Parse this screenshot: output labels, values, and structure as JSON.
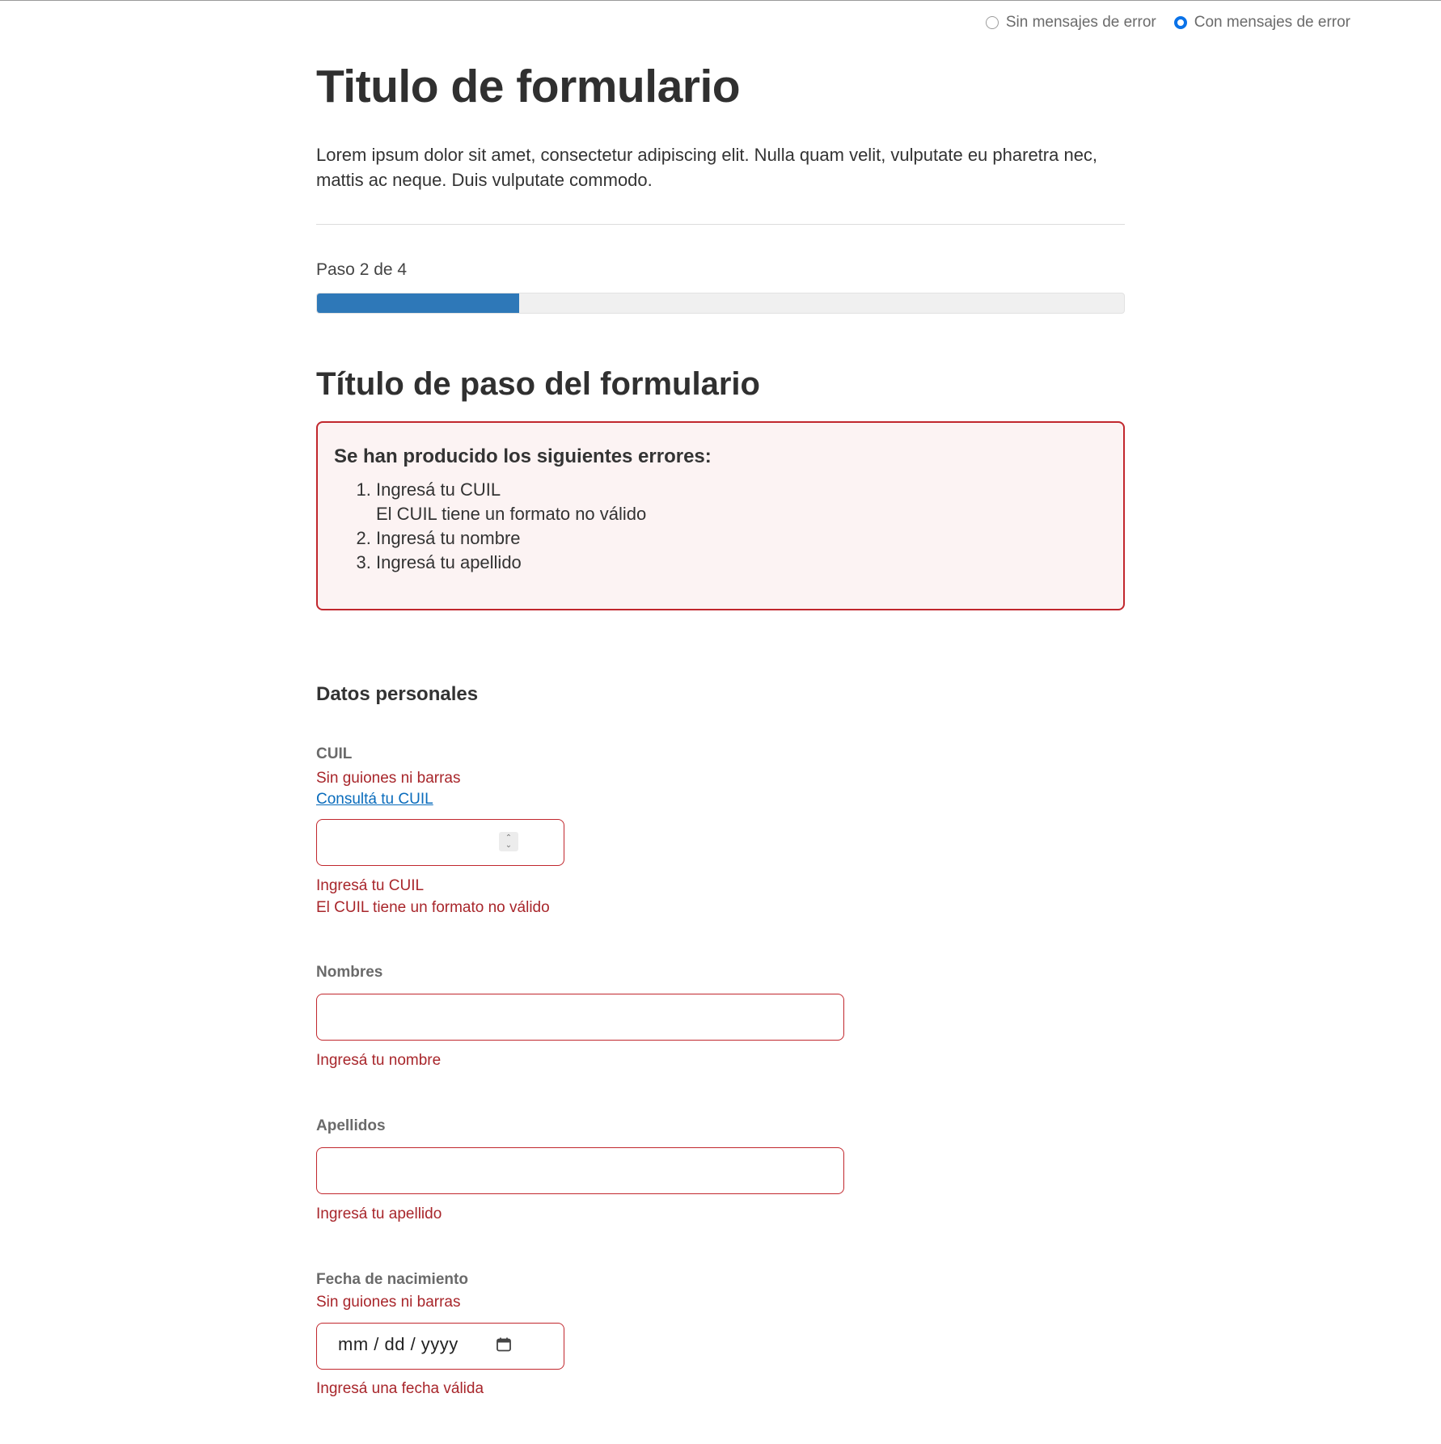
{
  "error_mode": {
    "options": [
      {
        "label": "Sin mensajes de error",
        "selected": false
      },
      {
        "label": "Con mensajes de error",
        "selected": true
      }
    ]
  },
  "form": {
    "title": "Titulo de formulario",
    "intro": "Lorem ipsum dolor sit amet, consectetur adipiscing elit. Nulla quam velit, vulputate eu pharetra nec, mattis ac neque. Duis vulputate commodo."
  },
  "progress": {
    "label": "Paso 2 de 4",
    "fraction": 0.25
  },
  "step_title": "Título de paso del formulario",
  "error_summary": {
    "title": "Se han producido los siguientes errores:",
    "items": [
      {
        "line1": "Ingresá tu CUIL",
        "line2": "El CUIL tiene un formato no válido"
      },
      {
        "line1": "Ingresá tu nombre"
      },
      {
        "line1": "Ingresá tu apellido"
      }
    ]
  },
  "section_title": "Datos personales",
  "fields": {
    "cuil": {
      "label": "CUIL",
      "hint": "Sin guiones ni barras",
      "link": "Consultá tu CUIL",
      "errors": [
        "Ingresá tu CUIL",
        "El CUIL tiene un formato no válido"
      ]
    },
    "nombres": {
      "label": "Nombres",
      "error": "Ingresá tu nombre"
    },
    "apellidos": {
      "label": "Apellidos",
      "error": "Ingresá tu apellido"
    },
    "fecha": {
      "label": "Fecha de nacimiento",
      "hint": "Sin guiones ni barras",
      "placeholder": "mm / dd / yyyy",
      "error": "Ingresá una fecha válida"
    }
  },
  "colors": {
    "error": "#c1272d",
    "progress": "#2e78b8",
    "link": "#0a6cbc",
    "radio_selected": "#0a72e8"
  },
  "icons": [
    "radio-icon",
    "spinner-icon",
    "calendar-icon"
  ]
}
